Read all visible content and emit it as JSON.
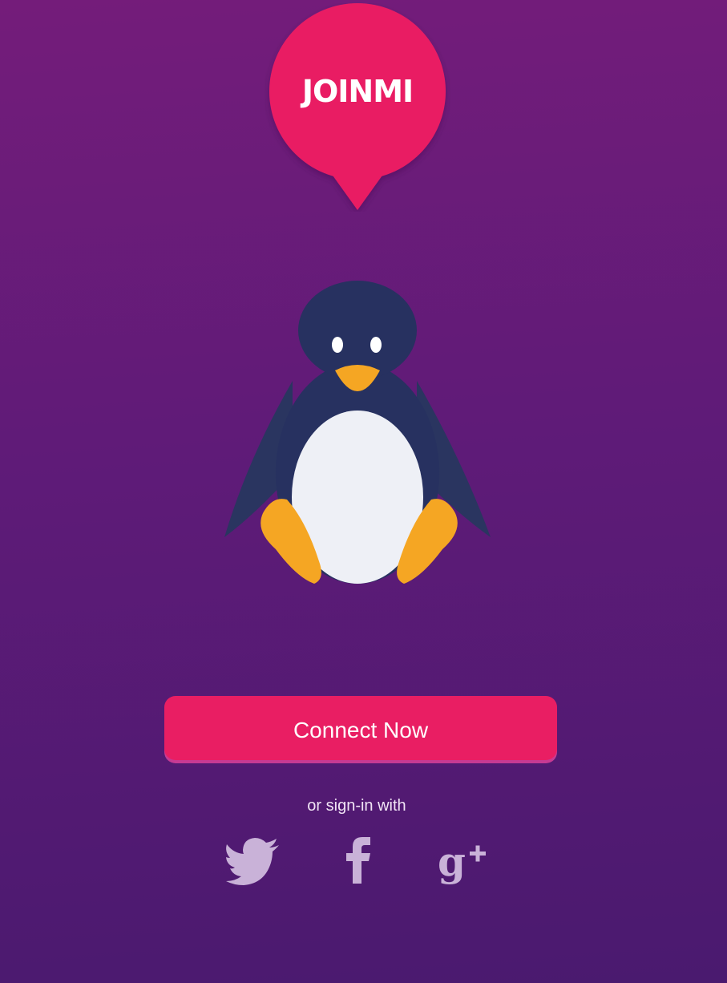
{
  "app": {
    "logo_text": "JOINMI"
  },
  "mascot": {
    "icon": "penguin"
  },
  "actions": {
    "connect_label": "Connect Now",
    "signin_prompt": "or sign-in with"
  },
  "social": [
    {
      "name": "twitter",
      "icon": "twitter-bird-icon"
    },
    {
      "name": "facebook",
      "icon": "facebook-f-icon"
    },
    {
      "name": "google-plus",
      "icon": "google-plus-icon"
    }
  ],
  "colors": {
    "accent": "#e91e63",
    "background_top": "#741c7a",
    "background_bottom": "#4a1a6f",
    "social_icon": "#c9b2d8"
  }
}
